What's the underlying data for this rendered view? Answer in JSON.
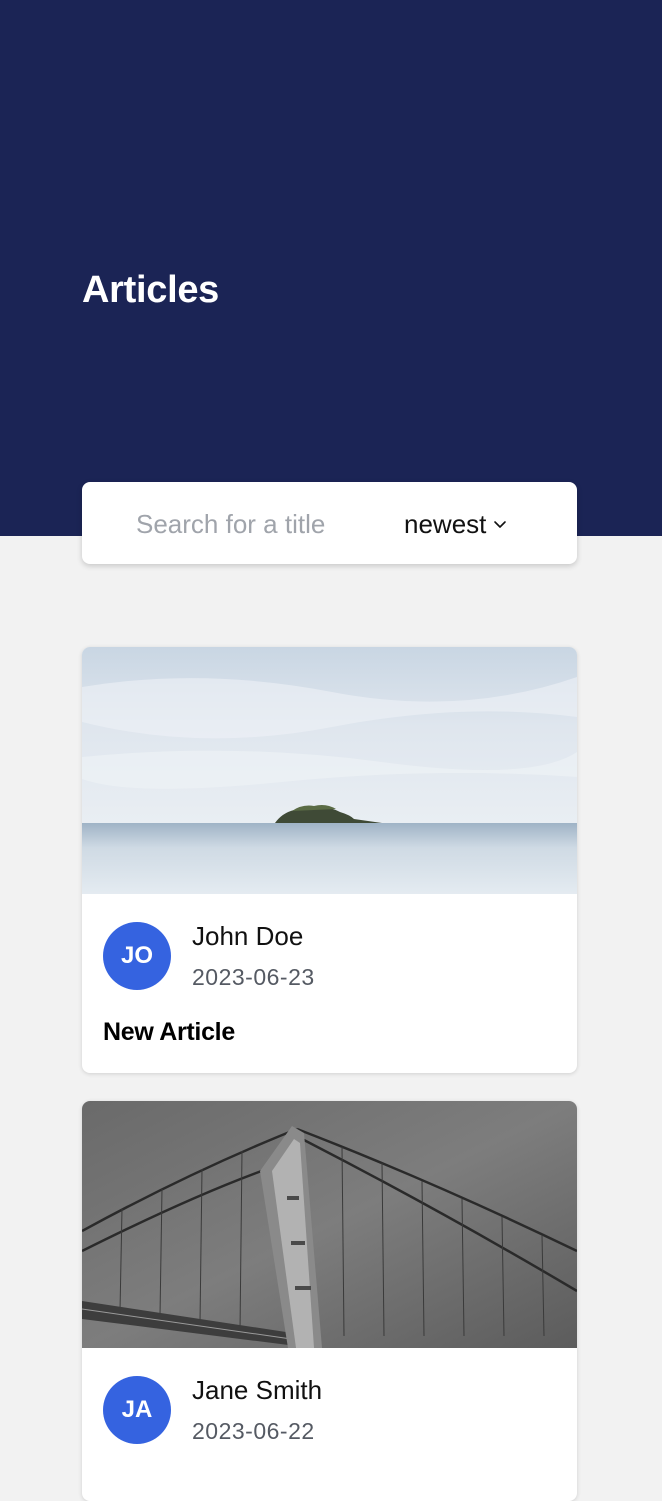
{
  "header": {
    "title": "Articles",
    "background_color": "#1b2455"
  },
  "search": {
    "placeholder": "Search for a title",
    "value": "",
    "sort_value": "newest",
    "sort_icon": "chevron-down-icon"
  },
  "articles": [
    {
      "image": "seascape-island-photo",
      "avatar_initials": "JO",
      "author": "John Doe",
      "date": "2023-06-23",
      "title": "New Article"
    },
    {
      "image": "bridge-aerial-photo",
      "avatar_initials": "JA",
      "author": "Jane Smith",
      "date": "2023-06-22",
      "title": ""
    }
  ],
  "colors": {
    "accent": "#3563e0",
    "page_background": "#f2f2f2"
  }
}
